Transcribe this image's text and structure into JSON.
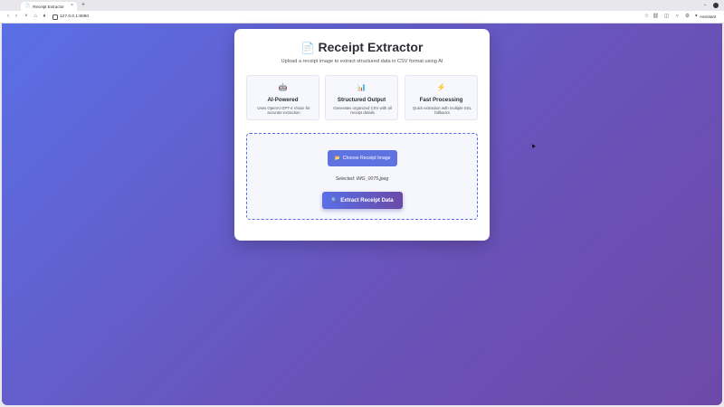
{
  "browser": {
    "tab_title": "Receipt Extractor",
    "new_tab_label": "+",
    "url": "127.0.0.1:8080",
    "assistant_label": "Assistant"
  },
  "page": {
    "title_icon": "📄",
    "title": "Receipt Extractor",
    "subtitle": "Upload a receipt image to extract structured data in CSV format using AI",
    "features": [
      {
        "icon": "🤖",
        "title": "AI-Powered",
        "description": "Uses OpenAI GPT-4 Vision for accurate extraction"
      },
      {
        "icon": "📊",
        "title": "Structured Output",
        "description": "Generates organized CSV with all receipt details"
      },
      {
        "icon": "⚡",
        "title": "Fast Processing",
        "description": "Quick extraction with multiple SSL fallbacks"
      }
    ],
    "choose_button": {
      "icon": "📂",
      "label": "Choose Receipt Image"
    },
    "selected_file": "Selected: IMG_0075.jpeg",
    "extract_button": {
      "icon": "🔍",
      "label": "Extract Receipt Data"
    }
  },
  "colors": {
    "gradient_start": "#5a6fe6",
    "gradient_end": "#6c4aa8",
    "button_primary": "#5e72e0"
  }
}
